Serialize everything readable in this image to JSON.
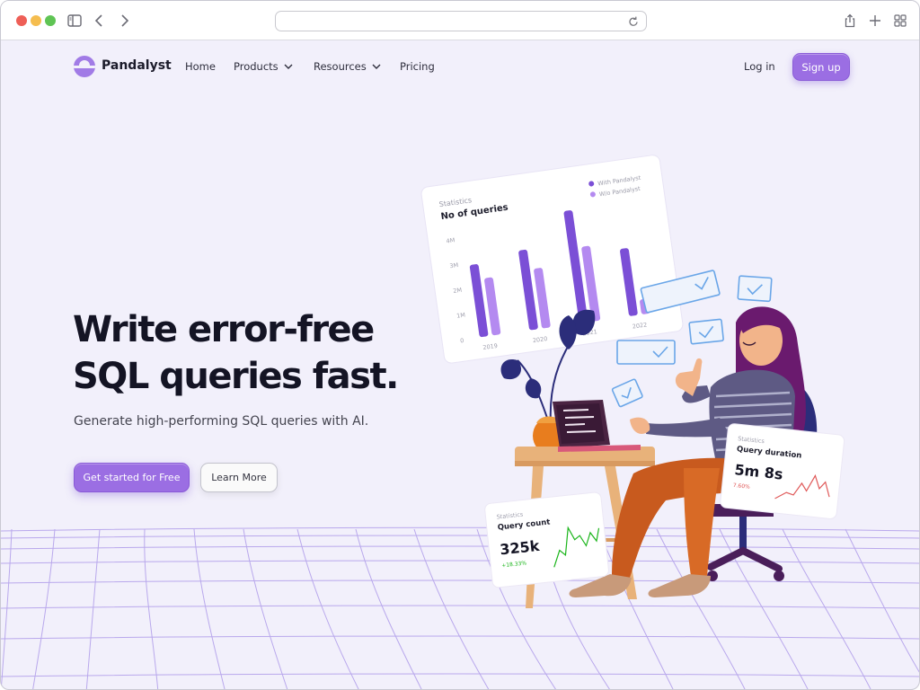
{
  "browser": {
    "url": "",
    "icons": [
      "sidebar-icon",
      "back-icon",
      "forward-icon",
      "reload-icon",
      "share-icon",
      "new-tab-icon",
      "tab-overview-icon"
    ]
  },
  "nav": {
    "brand": "Pandalyst",
    "links": [
      {
        "label": "Home",
        "has_dropdown": false
      },
      {
        "label": "Products",
        "has_dropdown": true
      },
      {
        "label": "Resources",
        "has_dropdown": true
      },
      {
        "label": "Pricing",
        "has_dropdown": false
      }
    ],
    "login": "Log in",
    "signup": "Sign up"
  },
  "hero": {
    "title_line1": "Write error-free",
    "title_line2": "SQL queries fast.",
    "subtitle": "Generate high-performing SQL queries with AI.",
    "cta_primary": "Get started for Free",
    "cta_secondary": "Learn More"
  },
  "colors": {
    "accent": "#9b6ee3",
    "background": "#f2f0fb",
    "bar_with": "#7b4fd6",
    "bar_without": "#b48af0",
    "trend_green": "#1bb51b",
    "trend_red": "#e05a5a",
    "check_blue": "#6aa6e8"
  },
  "stats_card": {
    "label": "Statistics",
    "title": "No of queries",
    "legend": [
      "With Pandalyst",
      "W/o Pandalyst"
    ],
    "y_ticks": [
      "4M",
      "3M",
      "2M",
      "1M",
      "0"
    ],
    "chart_data": {
      "type": "bar",
      "categories": [
        "2019",
        "2020",
        "2021",
        "2022"
      ],
      "ylim": [
        0,
        4
      ],
      "series": [
        {
          "name": "With Pandalyst",
          "values": [
            2.9,
            3.2,
            4.5,
            2.7
          ]
        },
        {
          "name": "W/o Pandalyst",
          "values": [
            2.3,
            2.4,
            3.0,
            0.6
          ]
        }
      ]
    }
  },
  "duration_card": {
    "label": "Statistics",
    "title": "Query duration",
    "value": "5m 8s",
    "delta": "7.60%"
  },
  "count_card": {
    "label": "Statistics",
    "title": "Query count",
    "value": "325k",
    "delta": "+18.33%"
  }
}
